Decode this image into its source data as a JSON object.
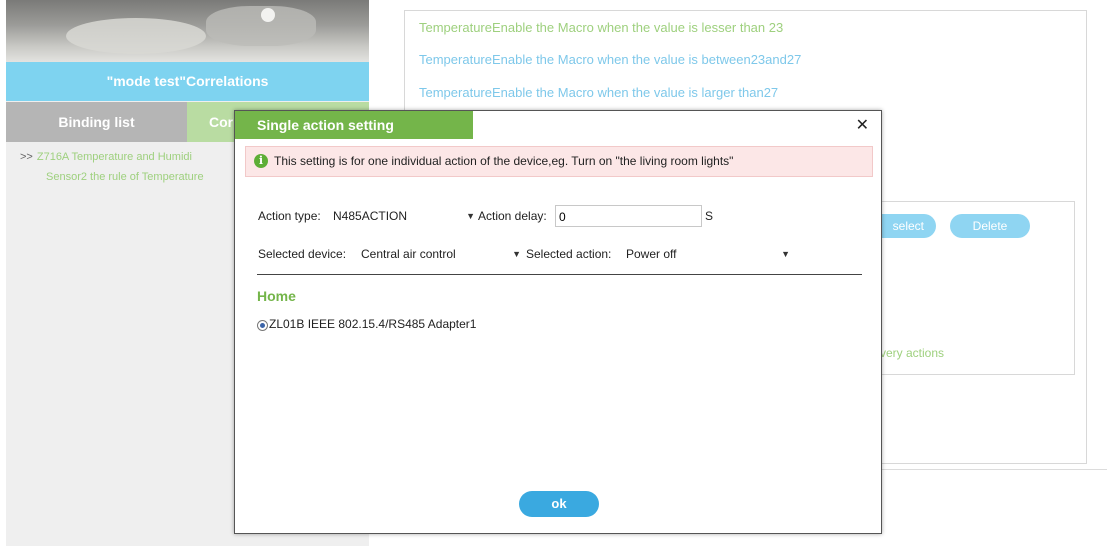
{
  "left_panel": {
    "correlations_title": "\"mode test\"Correlations",
    "tabs": {
      "binding": "Binding list",
      "correlation": "Cor"
    },
    "tree": {
      "arrow": ">>",
      "line1": "Z716A Temperature and Humidi",
      "line2": "Sensor2 the rule of Temperature"
    }
  },
  "right_panel": {
    "conditions": [
      "TemperatureEnable the Macro when the value is lesser than 23",
      "TemperatureEnable the Macro when the value is between23and27",
      "TemperatureEnable the Macro when the value is larger than27"
    ],
    "unselect_button": "select",
    "delete_button": "Delete",
    "every_actions": "very actions"
  },
  "dialog": {
    "title": "Single action setting",
    "close_icon": "close-icon",
    "notice": "This setting is for one individual action of the device,eg. Turn on \"the living room lights\"",
    "info_icon": "i",
    "action_type_label": "Action type:",
    "action_type_value": "N485ACTION",
    "action_delay_label": "Action delay:",
    "action_delay_value": "0",
    "delay_unit": "S",
    "selected_device_label": "Selected device:",
    "selected_device_value": "Central air control",
    "selected_action_label": "Selected action:",
    "selected_action_value": "Power off",
    "home_label": "Home",
    "device_option": "ZL01B IEEE 802.15.4/RS485 Adapter1",
    "ok_button": "ok"
  },
  "colors": {
    "green_accent": "#74b54a",
    "blue_accent": "#7ed3f0",
    "ok_blue": "#3aa9e0"
  }
}
